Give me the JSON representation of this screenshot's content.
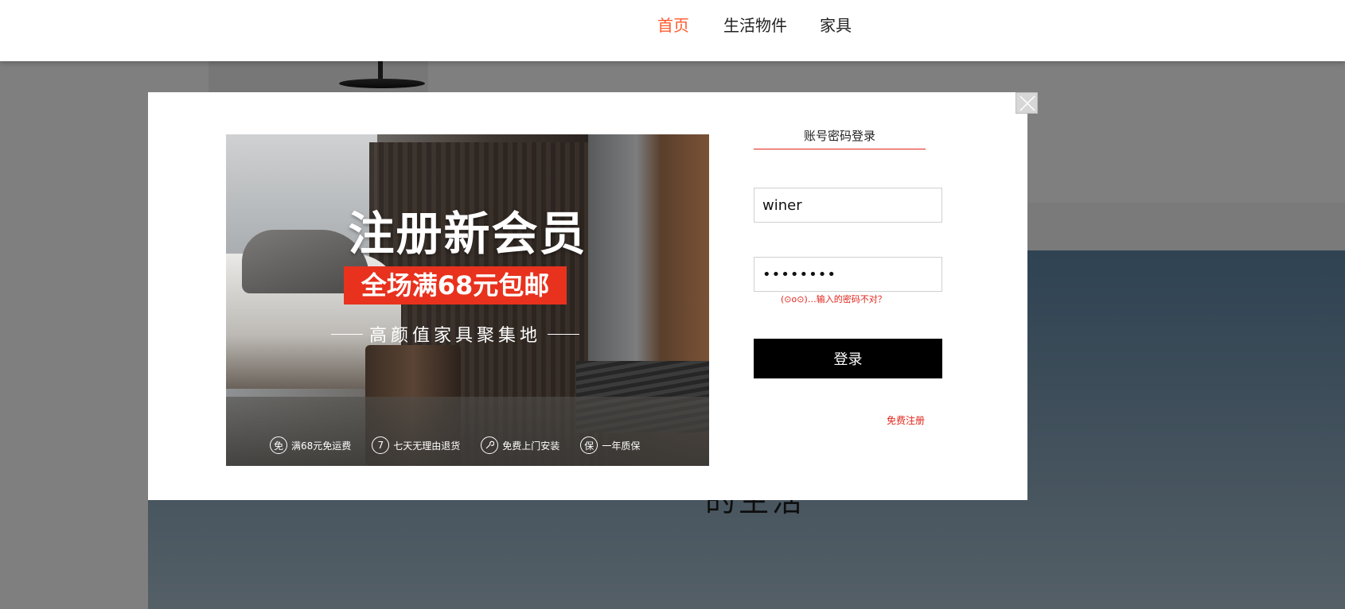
{
  "nav": {
    "items": [
      {
        "label": "首页",
        "active": true
      },
      {
        "label": "生活物件",
        "active": false
      },
      {
        "label": "家具",
        "active": false
      }
    ]
  },
  "background": {
    "slogan": "的生活"
  },
  "modal": {
    "promo": {
      "title": "注册新会员",
      "offer": "全场满68元包邮",
      "tagline": "高颜值家具聚集地",
      "features": [
        {
          "icon_char": "免",
          "label": "满68元免运费"
        },
        {
          "icon_char": "7",
          "label": "七天无理由退货"
        },
        {
          "icon_char": "🔧",
          "label": "免费上门安装"
        },
        {
          "icon_char": "保",
          "label": "一年质保"
        }
      ],
      "accent_color": "#e8321e"
    },
    "login": {
      "tab_label": "账号密码登录",
      "username_value": "winer",
      "password_value": "••••••••",
      "error_message": "(⊙o⊙)…输入的密码不对？",
      "submit_label": "登录",
      "register_label": "免费注册",
      "accent_color": "#e1251b"
    },
    "close_icon": "close-icon"
  }
}
